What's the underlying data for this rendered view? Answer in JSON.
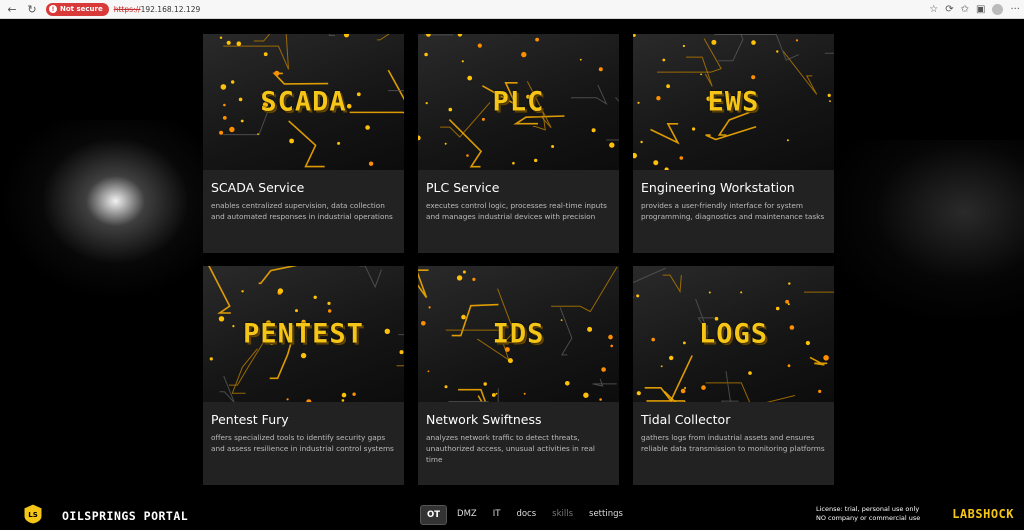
{
  "browser": {
    "security_badge": "Not secure",
    "url_scheme": "https://",
    "url_host": "192.168.12.129"
  },
  "cards": [
    {
      "label": "SCADA",
      "title": "SCADA Service",
      "description": "enables centralized supervision, data collection and automated responses in industrial operations"
    },
    {
      "label": "PLC",
      "title": "PLC Service",
      "description": "executes control logic, processes real-time inputs and manages industrial devices with precision"
    },
    {
      "label": "EWS",
      "title": "Engineering Workstation",
      "description": "provides a user-friendly interface for system programming, diagnostics and maintenance tasks"
    },
    {
      "label": "PENTEST",
      "title": "Pentest Fury",
      "description": "offers specialized tools to identify security gaps and assess resilience in industrial control systems"
    },
    {
      "label": "IDS",
      "title": "Network Swiftness",
      "description": "analyzes network traffic to detect threats, unauthorized access, unusual activities in real time"
    },
    {
      "label": "LOGS",
      "title": "Tidal Collector",
      "description": "gathers logs from industrial assets and ensures reliable data transmission to monitoring platforms"
    }
  ],
  "footer": {
    "logo_text": "LS",
    "portal_name": "OILSPRINGS PORTAL",
    "nav": [
      {
        "label": "OT",
        "state": "active"
      },
      {
        "label": "DMZ",
        "state": "normal"
      },
      {
        "label": "IT",
        "state": "normal"
      },
      {
        "label": "docs",
        "state": "normal"
      },
      {
        "label": "skills",
        "state": "disabled"
      },
      {
        "label": "settings",
        "state": "normal"
      }
    ],
    "license_line1": "License: trial, personal use only",
    "license_line2": "NO company or commercial use",
    "brand": "LABSHOCK"
  },
  "colors": {
    "accent": "#f5c518",
    "card_bg": "#222222",
    "page_bg": "#000000"
  }
}
